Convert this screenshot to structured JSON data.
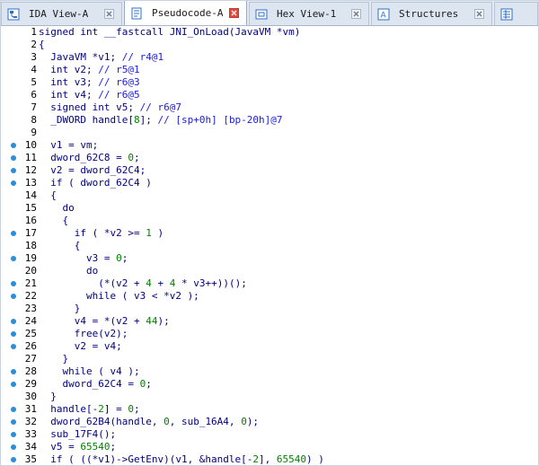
{
  "tabs": [
    {
      "label": "IDA View-A",
      "icon": "ida-view-icon",
      "active": false
    },
    {
      "label": "Pseudocode-A",
      "icon": "pseudocode-icon",
      "active": true
    },
    {
      "label": "Hex View-1",
      "icon": "hex-view-icon",
      "active": false
    },
    {
      "label": "Structures",
      "icon": "structures-icon",
      "active": false
    },
    {
      "label": "",
      "icon": "enums-icon",
      "active": false
    }
  ],
  "colors": {
    "keyword": "#000080",
    "number": "#008000",
    "comment": "#1a1ae0",
    "breakpoint": "#2c8ed6",
    "close_active": "#e04b3c"
  },
  "code": [
    {
      "n": "1",
      "bp": false,
      "text": "signed int __fastcall JNI_OnLoad(JavaVM *vm)"
    },
    {
      "n": "2",
      "bp": false,
      "text": "{"
    },
    {
      "n": "3",
      "bp": false,
      "text": "  JavaVM *v1; // r4@1"
    },
    {
      "n": "4",
      "bp": false,
      "text": "  int v2; // r5@1"
    },
    {
      "n": "5",
      "bp": false,
      "text": "  int v3; // r6@3"
    },
    {
      "n": "6",
      "bp": false,
      "text": "  int v4; // r6@5"
    },
    {
      "n": "7",
      "bp": false,
      "text": "  signed int v5; // r6@7"
    },
    {
      "n": "8",
      "bp": false,
      "text": "  _DWORD handle[8]; // [sp+0h] [bp-20h]@7"
    },
    {
      "n": "9",
      "bp": false,
      "text": ""
    },
    {
      "n": "10",
      "bp": true,
      "text": "  v1 = vm;"
    },
    {
      "n": "11",
      "bp": true,
      "text": "  dword_62C8 = 0;"
    },
    {
      "n": "12",
      "bp": true,
      "text": "  v2 = dword_62C4;"
    },
    {
      "n": "13",
      "bp": true,
      "text": "  if ( dword_62C4 )"
    },
    {
      "n": "14",
      "bp": false,
      "text": "  {"
    },
    {
      "n": "15",
      "bp": false,
      "text": "    do"
    },
    {
      "n": "16",
      "bp": false,
      "text": "    {"
    },
    {
      "n": "17",
      "bp": true,
      "text": "      if ( *v2 >= 1 )"
    },
    {
      "n": "18",
      "bp": false,
      "text": "      {"
    },
    {
      "n": "19",
      "bp": true,
      "text": "        v3 = 0;"
    },
    {
      "n": "20",
      "bp": false,
      "text": "        do"
    },
    {
      "n": "21",
      "bp": true,
      "text": "          (*(v2 + 4 + 4 * v3++))();"
    },
    {
      "n": "22",
      "bp": true,
      "text": "        while ( v3 < *v2 );"
    },
    {
      "n": "23",
      "bp": false,
      "text": "      }"
    },
    {
      "n": "24",
      "bp": true,
      "text": "      v4 = *(v2 + 44);"
    },
    {
      "n": "25",
      "bp": true,
      "text": "      free(v2);"
    },
    {
      "n": "26",
      "bp": true,
      "text": "      v2 = v4;"
    },
    {
      "n": "27",
      "bp": false,
      "text": "    }"
    },
    {
      "n": "28",
      "bp": true,
      "text": "    while ( v4 );"
    },
    {
      "n": "29",
      "bp": true,
      "text": "    dword_62C4 = 0;"
    },
    {
      "n": "30",
      "bp": false,
      "text": "  }"
    },
    {
      "n": "31",
      "bp": true,
      "text": "  handle[-2] = 0;"
    },
    {
      "n": "32",
      "bp": true,
      "text": "  dword_62B4(handle, 0, sub_16A4, 0);"
    },
    {
      "n": "33",
      "bp": true,
      "text": "  sub_17F4();"
    },
    {
      "n": "34",
      "bp": true,
      "text": "  v5 = 65540;"
    },
    {
      "n": "35",
      "bp": true,
      "text": "  if ( ((*v1)->GetEnv)(v1, &handle[-2], 65540) )"
    }
  ]
}
